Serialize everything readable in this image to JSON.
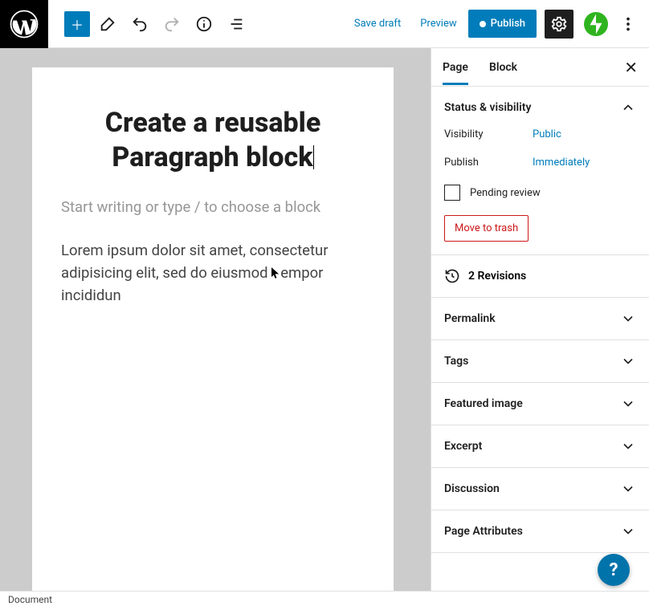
{
  "toolbar": {
    "save_draft": "Save draft",
    "preview": "Preview",
    "publish": "Publish"
  },
  "canvas": {
    "title": "Create a reusable Paragraph block",
    "placeholder": "Start writing or type / to choose a block",
    "paragraph_a": "Lorem ipsum dolor sit amet, consectetur adipisicing elit, sed do eiusmod ",
    "paragraph_b": "empor incididun"
  },
  "sidebar_tabs": {
    "page": "Page",
    "block": "Block"
  },
  "status_panel": {
    "title": "Status & visibility",
    "visibility_label": "Visibility",
    "visibility_value": "Public",
    "publish_label": "Publish",
    "publish_value": "Immediately",
    "pending_review": "Pending review",
    "trash": "Move to trash"
  },
  "revisions": {
    "count": "2 Revisions"
  },
  "panels": {
    "permalink": "Permalink",
    "tags": "Tags",
    "featured": "Featured image",
    "excerpt": "Excerpt",
    "discussion": "Discussion",
    "attributes": "Page Attributes"
  },
  "bottom": {
    "crumb": "Document"
  },
  "help": {
    "label": "?"
  }
}
